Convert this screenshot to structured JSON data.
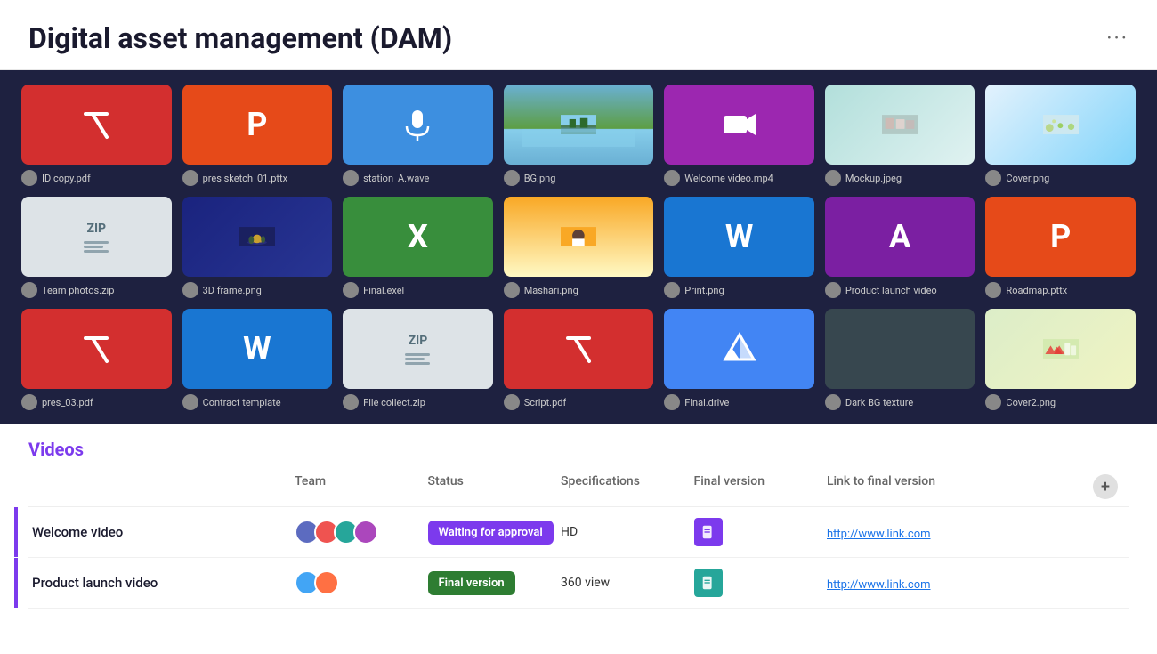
{
  "header": {
    "title": "Digital asset management (DAM)",
    "menu_label": "···"
  },
  "grid": {
    "items": [
      {
        "id": "id-copy-pdf",
        "filename": "ID copy.pdf",
        "type": "pdf",
        "bg": "bg-red",
        "avatar": "av1"
      },
      {
        "id": "pres-sketch",
        "filename": "pres sketch_01.pttx",
        "type": "pptx",
        "bg": "bg-orange-red",
        "avatar": "av2"
      },
      {
        "id": "station-a",
        "filename": "station_A.wave",
        "type": "audio",
        "bg": "bg-blue",
        "avatar": "av3"
      },
      {
        "id": "bg-png",
        "filename": "BG.png",
        "type": "photo-lake",
        "bg": "",
        "avatar": "av4"
      },
      {
        "id": "welcome-video",
        "filename": "Welcome video.mp4",
        "type": "video",
        "bg": "bg-purple",
        "avatar": "av5"
      },
      {
        "id": "mockup-jpeg",
        "filename": "Mockup.jpeg",
        "type": "photo-mockup",
        "bg": "",
        "avatar": "av6"
      },
      {
        "id": "cover-png",
        "filename": "Cover.png",
        "type": "photo-cover",
        "bg": "",
        "avatar": "av7"
      },
      {
        "id": "team-photos-zip",
        "filename": "Team photos.zip",
        "type": "zip",
        "bg": "bg-zip",
        "avatar": "av8"
      },
      {
        "id": "3d-frame-png",
        "filename": "3D frame.png",
        "type": "photo-3d",
        "bg": "",
        "avatar": "av1"
      },
      {
        "id": "final-exel",
        "filename": "Final.exel",
        "type": "excel",
        "bg": "bg-green",
        "avatar": "av2"
      },
      {
        "id": "mashari-png",
        "filename": "Mashari.png",
        "type": "photo-mashari",
        "bg": "",
        "avatar": "av3"
      },
      {
        "id": "print-png",
        "filename": "Print.png",
        "type": "word-w",
        "bg": "bg-blue-w",
        "avatar": "av4"
      },
      {
        "id": "product-launch",
        "filename": "Product launch video",
        "type": "letter-a",
        "bg": "bg-purple-a",
        "avatar": "av5"
      },
      {
        "id": "roadmap-pttx",
        "filename": "Roadmap.pttx",
        "type": "letter-p",
        "bg": "bg-orange-p",
        "avatar": "av6"
      },
      {
        "id": "pres-03-pdf",
        "filename": "pres_03.pdf",
        "type": "pdf",
        "bg": "bg-red",
        "avatar": "av7"
      },
      {
        "id": "contract-template",
        "filename": "Contract template",
        "type": "word-w",
        "bg": "bg-blue-w",
        "avatar": "av8"
      },
      {
        "id": "file-collect-zip",
        "filename": "File collect.zip",
        "type": "zip",
        "bg": "bg-zip",
        "avatar": "av1"
      },
      {
        "id": "script-pdf",
        "filename": "Script.pdf",
        "type": "pdf",
        "bg": "bg-red",
        "avatar": "av2"
      },
      {
        "id": "final-drive",
        "filename": "Final.drive",
        "type": "drive",
        "bg": "bg-blue-drive",
        "avatar": "av3"
      },
      {
        "id": "dark-bg-texture",
        "filename": "Dark BG texture",
        "type": "photo-dark",
        "bg": "",
        "avatar": "av4"
      },
      {
        "id": "cover2-png",
        "filename": "Cover2.png",
        "type": "photo-cover2",
        "bg": "",
        "avatar": "av5"
      }
    ]
  },
  "table_section": {
    "title": "Videos",
    "columns": [
      "",
      "Team",
      "Status",
      "Specifications",
      "Final version",
      "Link to final version",
      ""
    ],
    "rows": [
      {
        "title": "Welcome video",
        "team_avatars": [
          "av1",
          "av2",
          "av3",
          "av4"
        ],
        "status": "Waiting for approval",
        "status_class": "status-waiting",
        "spec": "HD",
        "file_icon_color": "file-icon-purple",
        "link": "http://www.link.com"
      },
      {
        "title": "Product launch video",
        "team_avatars": [
          "av5",
          "av6"
        ],
        "status": "Final version",
        "status_class": "status-final",
        "spec": "360 view",
        "file_icon_color": "file-icon-teal",
        "link": "http://www.link.com"
      }
    ],
    "add_button_label": "+"
  }
}
